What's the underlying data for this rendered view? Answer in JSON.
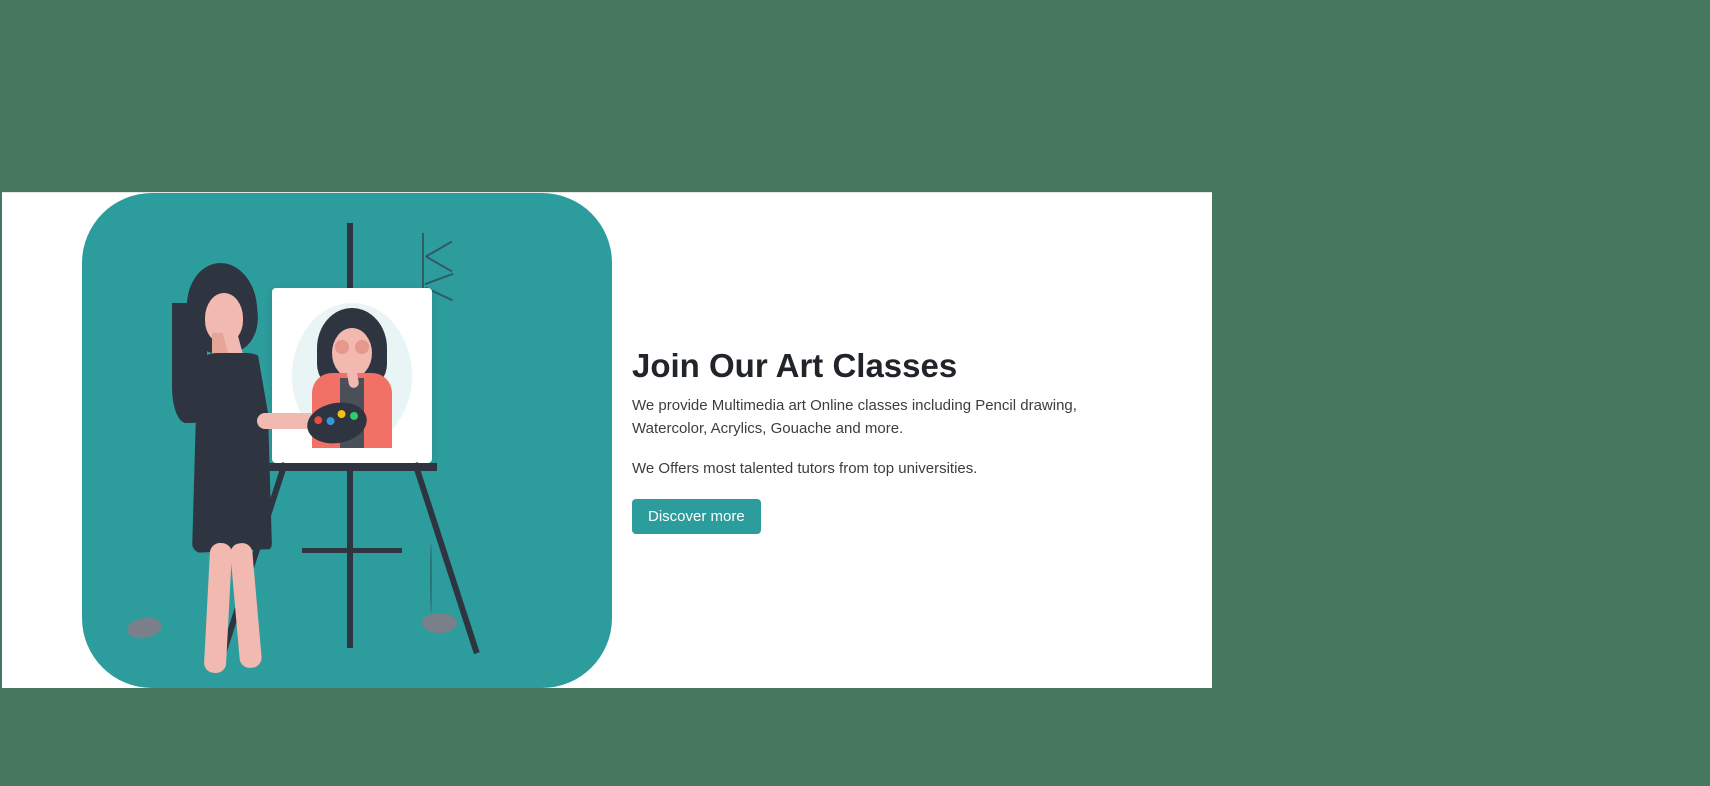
{
  "main": {
    "heading": "Join Our Art Classes",
    "paragraph1": "We provide Multimedia art Online classes including Pencil drawing, Watercolor, Acrylics, Gouache and more.",
    "paragraph2": "We Offers most talented tutors from top universities.",
    "cta_label": "Discover more"
  },
  "colors": {
    "background": "#46785f",
    "accent": "#2d9c9c",
    "text": "#212529"
  }
}
